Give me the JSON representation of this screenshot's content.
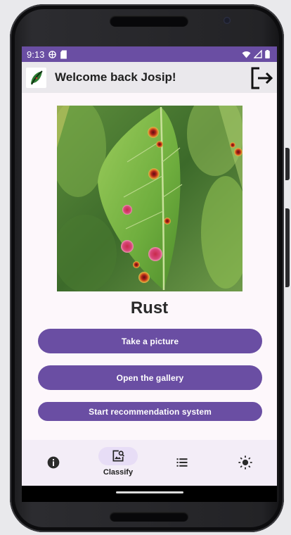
{
  "status_bar": {
    "time": "9:13"
  },
  "app_bar": {
    "title": "Welcome back Josip!"
  },
  "result": {
    "label": "Rust"
  },
  "buttons": {
    "take_picture": "Take a picture",
    "open_gallery": "Open the gallery",
    "recommendation": "Start recommendation system"
  },
  "bottom_nav": {
    "items": [
      {
        "icon": "info-icon",
        "label": ""
      },
      {
        "icon": "image-search-icon",
        "label": "Classify",
        "selected": true
      },
      {
        "icon": "list-icon",
        "label": ""
      },
      {
        "icon": "brightness-icon",
        "label": ""
      }
    ]
  },
  "colors": {
    "primary": "#6a4ea3",
    "app_bar": "#eae8ec",
    "nav_background": "#f3edf7",
    "nav_indicator": "#e7ddf6"
  }
}
